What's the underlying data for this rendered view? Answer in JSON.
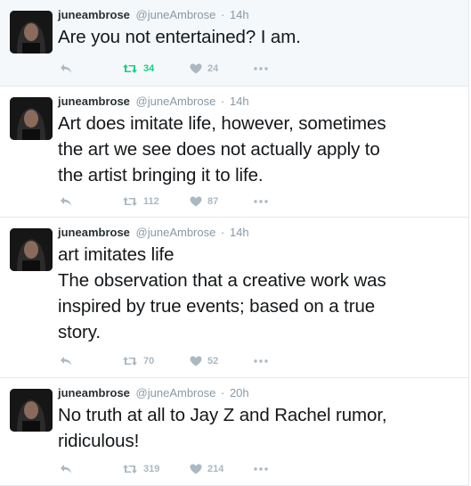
{
  "tweets": [
    {
      "name": "juneambrose",
      "handle": "@juneAmbrose",
      "separator": "·",
      "time": "14h",
      "lines": [
        "Are you not entertained? I am."
      ],
      "retweets": "34",
      "likes": "24",
      "retweeted": true
    },
    {
      "name": "juneambrose",
      "handle": "@juneAmbrose",
      "separator": "·",
      "time": "14h",
      "lines": [
        "Art does imitate life, however, sometimes",
        "the art we see does not actually apply to",
        "the artist bringing it to life."
      ],
      "retweets": "112",
      "likes": "87",
      "retweeted": false
    },
    {
      "name": "juneambrose",
      "handle": "@juneAmbrose",
      "separator": "·",
      "time": "14h",
      "lines": [
        "art imitates life",
        "The observation that a creative work was",
        "inspired by true events; based on a true",
        "story."
      ],
      "retweets": "70",
      "likes": "52",
      "retweeted": false
    },
    {
      "name": "juneambrose",
      "handle": "@juneAmbrose",
      "separator": "·",
      "time": "20h",
      "lines": [
        "No truth at all to Jay Z and Rachel rumor,",
        "ridiculous!"
      ],
      "retweets": "319",
      "likes": "214",
      "retweeted": false
    }
  ],
  "icons": {
    "reply": "reply-icon",
    "retweet": "retweet-icon",
    "like": "heart-icon",
    "more": "more-icon"
  },
  "colors": {
    "retweet_active": "#19cf86",
    "action_gray": "#aab8c2",
    "handle_gray": "#8899a6",
    "highlight_bg": "#f5f8fa"
  }
}
